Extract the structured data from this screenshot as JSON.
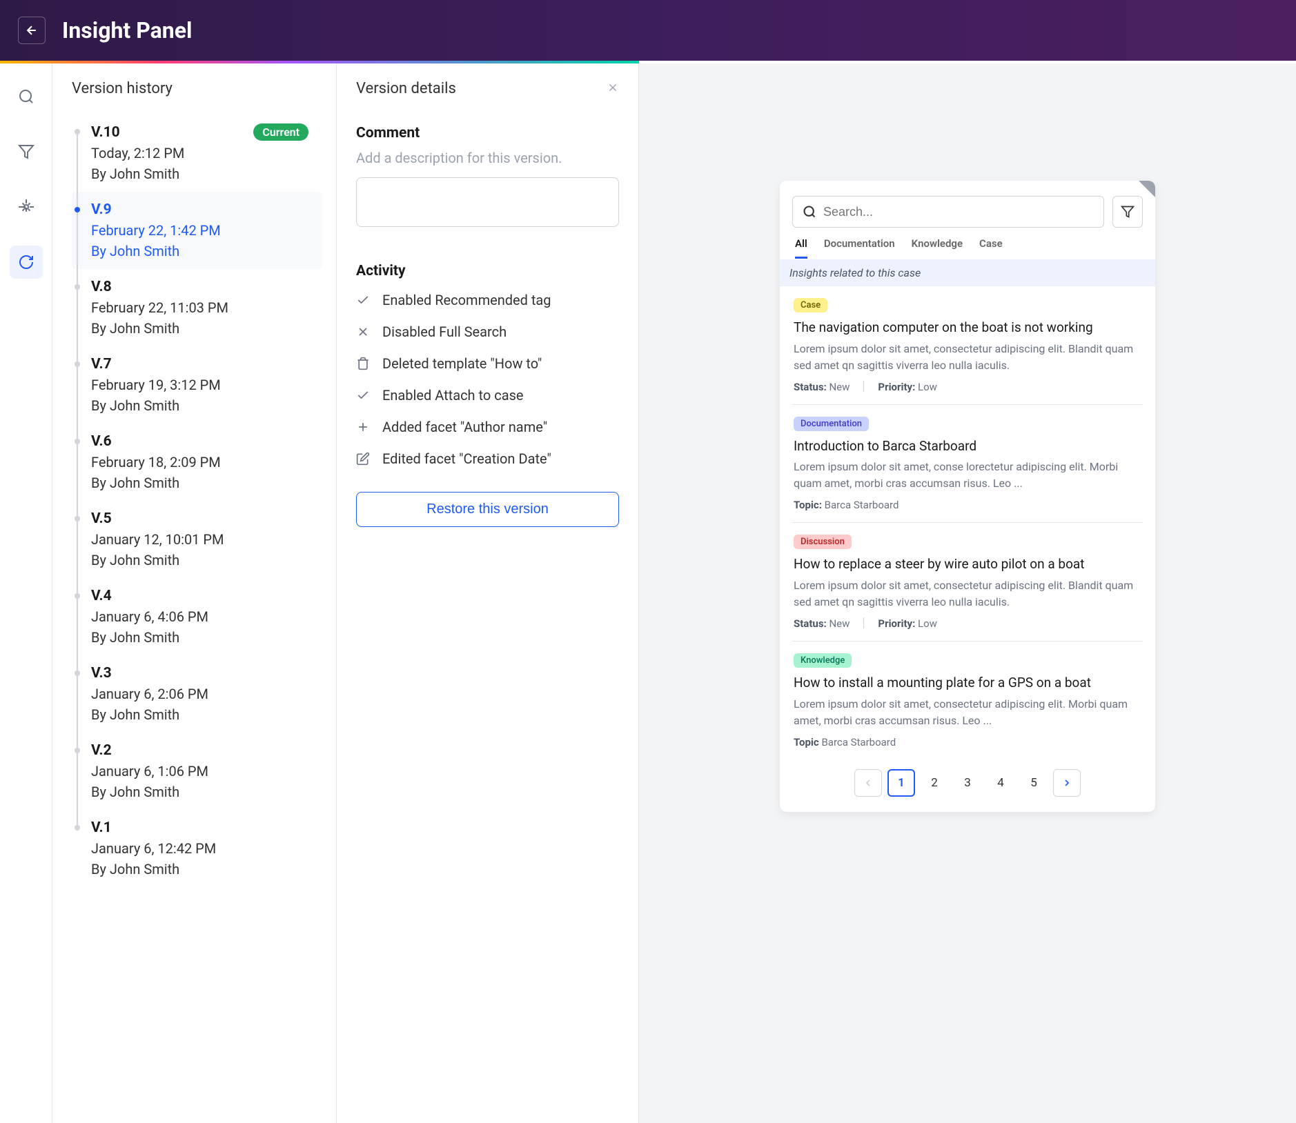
{
  "header": {
    "title": "Insight Panel"
  },
  "history": {
    "panel_title": "Version history",
    "current_badge": "Current",
    "versions": [
      {
        "name": "V.10",
        "date": "Today, 2:12 PM",
        "author": "By John Smith",
        "current": true,
        "selected": false
      },
      {
        "name": "V.9",
        "date": "February 22, 1:42 PM",
        "author": "By John Smith",
        "current": false,
        "selected": true
      },
      {
        "name": "V.8",
        "date": "February 22, 11:03 PM",
        "author": "By John Smith",
        "current": false,
        "selected": false
      },
      {
        "name": "V.7",
        "date": "February 19, 3:12 PM",
        "author": "By John Smith",
        "current": false,
        "selected": false
      },
      {
        "name": "V.6",
        "date": "February 18, 2:09 PM",
        "author": "By John Smith",
        "current": false,
        "selected": false
      },
      {
        "name": "V.5",
        "date": "January 12, 10:01 PM",
        "author": "By John Smith",
        "current": false,
        "selected": false
      },
      {
        "name": "V.4",
        "date": "January 6, 4:06 PM",
        "author": "By John Smith",
        "current": false,
        "selected": false
      },
      {
        "name": "V.3",
        "date": "January 6, 2:06 PM",
        "author": "By John Smith",
        "current": false,
        "selected": false
      },
      {
        "name": "V.2",
        "date": "January 6, 1:06 PM",
        "author": "By John Smith",
        "current": false,
        "selected": false
      },
      {
        "name": "V.1",
        "date": "January 6, 12:42 PM",
        "author": "By John Smith",
        "current": false,
        "selected": false
      }
    ]
  },
  "details": {
    "panel_title": "Version details",
    "comment_label": "Comment",
    "comment_hint": "Add a description for this version.",
    "activity_label": "Activity",
    "activities": [
      {
        "icon": "check",
        "text": "Enabled Recommended tag"
      },
      {
        "icon": "x",
        "text": "Disabled Full Search"
      },
      {
        "icon": "trash",
        "text": "Deleted template \"How to\""
      },
      {
        "icon": "check",
        "text": "Enabled Attach to case"
      },
      {
        "icon": "plus",
        "text": "Added  facet \"Author name\""
      },
      {
        "icon": "edit",
        "text": "Edited  facet \"Creation Date\""
      }
    ],
    "restore_btn": "Restore this version"
  },
  "preview": {
    "search_placeholder": "Search...",
    "tabs": [
      "All",
      "Documentation",
      "Knowledge",
      "Case"
    ],
    "banner": "Insights related to this case",
    "results": [
      {
        "badge": "Case",
        "badge_class": "badge-case",
        "title": "The navigation computer on the boat is not working",
        "snippet": "Lorem ipsum dolor sit amet, consectetur adipiscing elit. Blandit quam sed amet qn sagittis viverra leo nulla iaculis.",
        "meta": [
          {
            "label": "Status:",
            "value": "New"
          },
          {
            "label": "Priority:",
            "value": "Low"
          }
        ]
      },
      {
        "badge": "Documentation",
        "badge_class": "badge-doc",
        "title": "Introduction to Barca Starboard",
        "snippet": "Lorem ipsum dolor sit amet, conse  lorectetur adipiscing elit. Morbi quam amet, morbi cras accumsan risus. Leo ...",
        "meta": [
          {
            "label": "Topic:",
            "value": "Barca Starboard"
          }
        ]
      },
      {
        "badge": "Discussion",
        "badge_class": "badge-disc",
        "title": "How to replace a steer by wire auto pilot on a boat",
        "snippet": "Lorem ipsum dolor sit amet, consectetur adipiscing elit. Blandit quam sed amet qn sagittis viverra leo nulla iaculis.",
        "meta": [
          {
            "label": "Status:",
            "value": "New"
          },
          {
            "label": "Priority:",
            "value": "Low"
          }
        ]
      },
      {
        "badge": "Knowledge",
        "badge_class": "badge-know",
        "title": "How to install a mounting plate for a GPS on a boat",
        "snippet": "Lorem ipsum dolor sit amet, consectetur adipiscing elit. Morbi quam amet, morbi cras accumsan risus. Leo ...",
        "meta": [
          {
            "label": "Topic",
            "value": "Barca Starboard"
          }
        ]
      }
    ],
    "pages": [
      "1",
      "2",
      "3",
      "4",
      "5"
    ]
  }
}
